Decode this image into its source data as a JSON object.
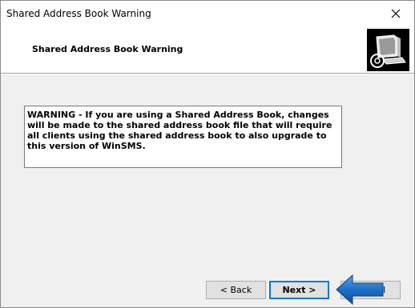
{
  "window": {
    "title": "Shared Address Book Warning"
  },
  "header": {
    "title": "Shared Address Book Warning",
    "logo_icon": "computer-disk-icon"
  },
  "warning": {
    "text": "WARNING - If you are using a Shared Address Book, changes will be made to the shared address book file that will require all clients using the shared address book to also upgrade to this version of WinSMS."
  },
  "buttons": {
    "back": "< Back",
    "next": "Next >",
    "cancel": "Cancel"
  },
  "colors": {
    "arrow": "#1e6fc4",
    "focus_border": "#0078d7"
  }
}
